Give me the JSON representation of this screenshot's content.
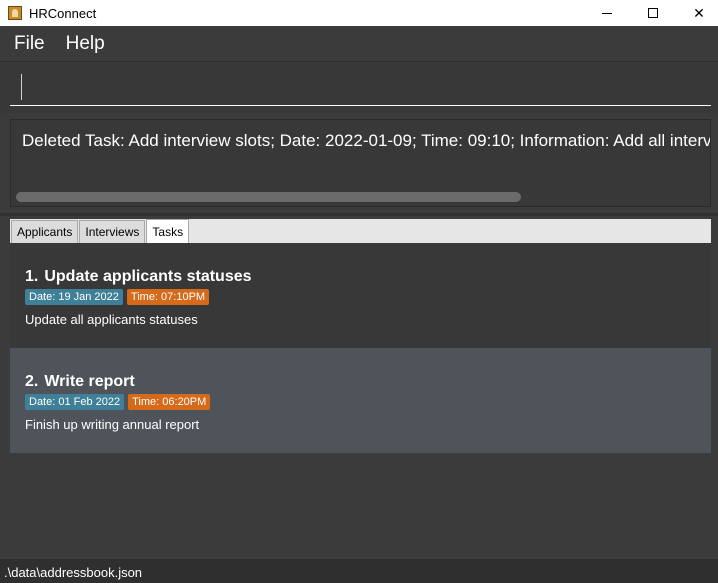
{
  "window": {
    "title": "HRConnect",
    "icons": {
      "app": "hrconnect-app-icon",
      "minimize": "minimize-icon",
      "maximize": "maximize-icon",
      "close": "close-icon"
    }
  },
  "menu": {
    "items": [
      "File",
      "Help"
    ]
  },
  "command": {
    "value": "",
    "placeholder": ""
  },
  "result": {
    "text": "Deleted Task: Add interview slots; Date: 2022-01-09; Time: 09:10; Information: Add all interviews"
  },
  "tabs": [
    {
      "label": "Applicants",
      "active": false
    },
    {
      "label": "Interviews",
      "active": false
    },
    {
      "label": "Tasks",
      "active": true
    }
  ],
  "tasks": [
    {
      "index": "1.",
      "title": "Update applicants statuses",
      "date": "Date: 19 Jan 2022",
      "time": "Time: 07:10PM",
      "info": "Update all applicants statuses"
    },
    {
      "index": "2.",
      "title": "Write report",
      "date": "Date: 01 Feb 2022",
      "time": "Time: 06:20PM",
      "info": "Finish up writing annual report"
    }
  ],
  "status": {
    "path": ".\\data\\addressbook.json"
  },
  "colors": {
    "date_badge": "#3f7f97",
    "time_badge": "#d46a1a",
    "background": "#3b3b3b",
    "selected_card": "#4e5459"
  }
}
